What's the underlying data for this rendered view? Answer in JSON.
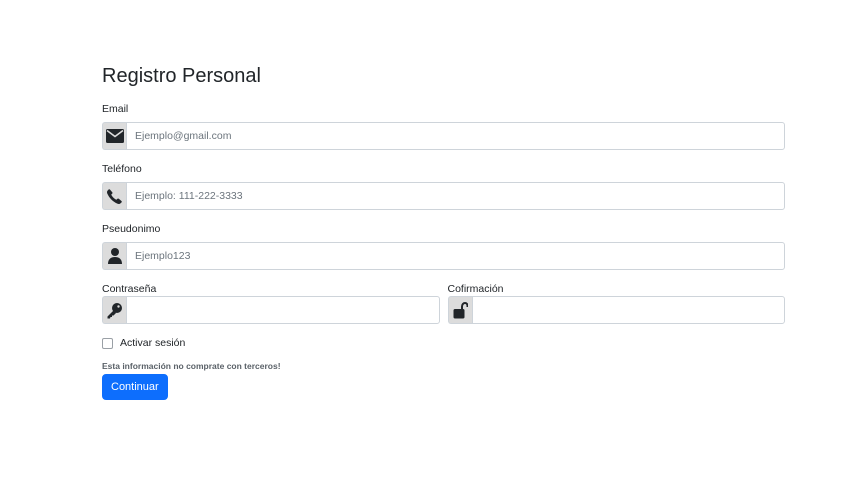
{
  "form": {
    "title": "Registro Personal",
    "email": {
      "label": "Email",
      "placeholder": "Ejemplo@gmail.com",
      "icon": "envelope-icon"
    },
    "phone": {
      "label": "Teléfono",
      "placeholder": "Ejemplo: 111-222-3333",
      "icon": "phone-icon"
    },
    "nickname": {
      "label": "Pseudonimo",
      "placeholder": "Ejemplo123",
      "icon": "user-icon"
    },
    "password": {
      "label": "Contraseña",
      "placeholder": "",
      "icon": "key-icon"
    },
    "confirmation": {
      "label": "Cofirmación",
      "placeholder": "",
      "icon": "unlock-icon"
    },
    "remember": {
      "label": "Activar sesión",
      "checked": false
    },
    "help_text": "Esta información no comprate con terceros!",
    "submit_label": "Continuar"
  },
  "colors": {
    "primary": "#0d6efd",
    "addon_bg": "#dcdcdc",
    "border": "#ced4da",
    "text": "#212529",
    "muted": "#6c757d"
  }
}
